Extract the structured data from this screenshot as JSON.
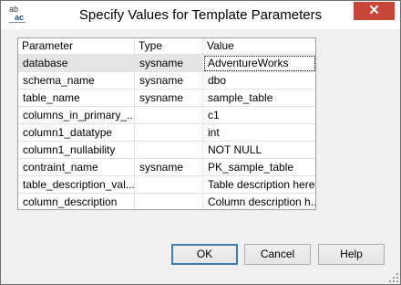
{
  "window": {
    "title": "Specify Values for Template Parameters",
    "close_glyph": "✕",
    "icon": "template-parameters-icon",
    "icon_text_top": "ab",
    "icon_text_bottom": "ac"
  },
  "grid": {
    "columns": [
      "Parameter",
      "Type",
      "Value"
    ],
    "rows": [
      {
        "parameter": "database",
        "type": "sysname",
        "value": "AdventureWorks"
      },
      {
        "parameter": "schema_name",
        "type": "sysname",
        "value": "dbo"
      },
      {
        "parameter": "table_name",
        "type": "sysname",
        "value": "sample_table"
      },
      {
        "parameter": "columns_in_primary_...",
        "type": "",
        "value": "c1"
      },
      {
        "parameter": "column1_datatype",
        "type": "",
        "value": "int"
      },
      {
        "parameter": "column1_nullability",
        "type": "",
        "value": "NOT NULL"
      },
      {
        "parameter": "contraint_name",
        "type": "sysname",
        "value": "PK_sample_table"
      },
      {
        "parameter": "table_description_val...",
        "type": "",
        "value": "Table description here"
      },
      {
        "parameter": "column_description",
        "type": "",
        "value": "Column description h..."
      }
    ]
  },
  "buttons": {
    "ok": "OK",
    "cancel": "Cancel",
    "help": "Help"
  },
  "colors": {
    "close_button": "#c7463a",
    "selected_row": "#e5e5e5",
    "dialog_background": "#f0f0f0",
    "default_button_border": "#3c7fb1"
  }
}
